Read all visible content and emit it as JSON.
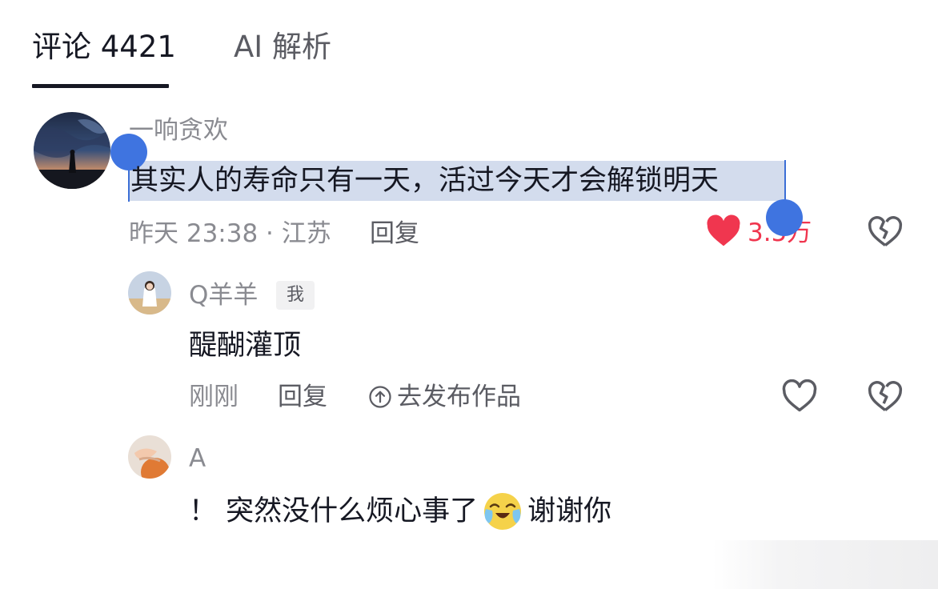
{
  "tabs": [
    {
      "label": "评论 4421",
      "active": true
    },
    {
      "label": "AI 解析",
      "active": false
    }
  ],
  "comments": [
    {
      "username": "一响贪欢",
      "text": "其实人的寿命只有一天，活过今天才会解锁明天",
      "time_location": "昨天 23:38 · 江苏",
      "reply_label": "回复",
      "like_count": "3.5万",
      "liked": true,
      "selected": true
    }
  ],
  "replies": [
    {
      "username": "Q羊羊",
      "badge": "我",
      "text": "醍醐灌顶",
      "time": "刚刚",
      "reply_label": "回复",
      "publish_label": "去发布作品"
    },
    {
      "username": "A",
      "text_prefix": "！ 突然没什么烦心事了",
      "emoji": "crying-laughing-emoji",
      "text_suffix": "谢谢你"
    }
  ],
  "colors": {
    "text_primary": "#161823",
    "text_secondary": "#8a8b91",
    "like_red": "#fe2c55",
    "selection_bg": "#d3dced",
    "selection_handle": "#3f74e0"
  },
  "icons": {
    "like": "heart-icon",
    "dislike": "broken-heart-icon",
    "publish": "upload-circle-icon"
  }
}
